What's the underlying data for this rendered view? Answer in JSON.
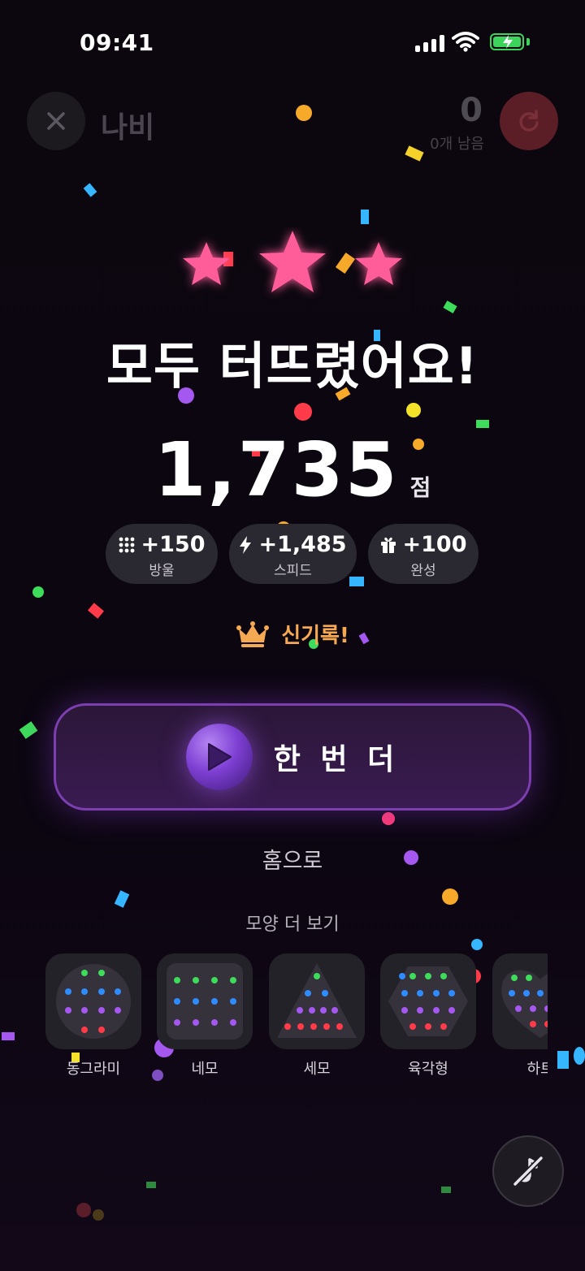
{
  "status_bar": {
    "time": "09:41",
    "icons": [
      "signal-icon",
      "wifi-icon",
      "battery-charging-icon"
    ]
  },
  "header": {
    "close_icon": "close-icon",
    "title": "나비",
    "bubbles_left": "0",
    "remaining_label": "0개 남음",
    "refresh_icon": "refresh-icon"
  },
  "result": {
    "stars_earned": 3,
    "stars_total": 3,
    "headline": "모두 터뜨렸어요!",
    "score": "1,735",
    "score_unit": "점",
    "bonuses": [
      {
        "icon": "bubble-grid-icon",
        "value": "+150",
        "label": "방울"
      },
      {
        "icon": "lightning-icon",
        "value": "+1,485",
        "label": "스피드"
      },
      {
        "icon": "gift-icon",
        "value": "+100",
        "label": "완성"
      }
    ],
    "record": {
      "icon": "crown-icon",
      "label": "신기록!"
    }
  },
  "actions": {
    "play_again": "한 번 더",
    "play_icon": "play-icon",
    "home": "홈으로"
  },
  "more_shapes": {
    "title": "모양 더 보기",
    "items": [
      {
        "label": "동그라미",
        "shape": "circle"
      },
      {
        "label": "네모",
        "shape": "square"
      },
      {
        "label": "세모",
        "shape": "triangle"
      },
      {
        "label": "육각형",
        "shape": "hexagon"
      },
      {
        "label": "하트",
        "shape": "heart"
      }
    ]
  },
  "sound_toggle": {
    "icon": "mute-icon"
  },
  "colors": {
    "star": "#ff5c9a",
    "accent_purple": "#7d3fd2",
    "record": "#f5a952",
    "refresh_bg": "#5b1e26",
    "bubble_green": "#3ddc5a",
    "bubble_blue": "#2f8cff",
    "bubble_purple": "#a558f0",
    "bubble_red": "#ff3b4a"
  }
}
